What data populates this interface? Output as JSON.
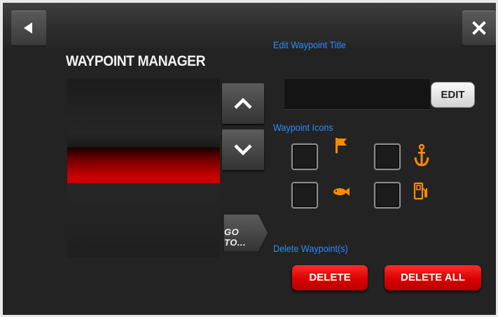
{
  "header": {
    "title": "WAYPOINT MANAGER",
    "back_icon": "back-arrow-icon",
    "close_icon": "close-icon"
  },
  "navigation": {
    "up_icon": "chevron-up-icon",
    "down_icon": "chevron-down-icon",
    "goto_label": "GO TO..."
  },
  "edit_title": {
    "label": "Edit Waypoint Title",
    "input_value": "",
    "edit_button": "EDIT"
  },
  "icons_section": {
    "label": "Waypoint Icons",
    "items": [
      {
        "icon": "flag-icon",
        "checked": false
      },
      {
        "icon": "anchor-icon",
        "checked": false
      },
      {
        "icon": "fish-icon",
        "checked": false
      },
      {
        "icon": "fuel-icon",
        "checked": false
      }
    ],
    "icon_color": "#ff8c00"
  },
  "delete_section": {
    "label": "Delete Waypoint(s)",
    "delete_button": "DELETE",
    "delete_all_button": "DELETE ALL"
  },
  "colors": {
    "accent_blue": "#2a8cff",
    "selection_red": "#d10000",
    "danger_red": "#e00000"
  }
}
